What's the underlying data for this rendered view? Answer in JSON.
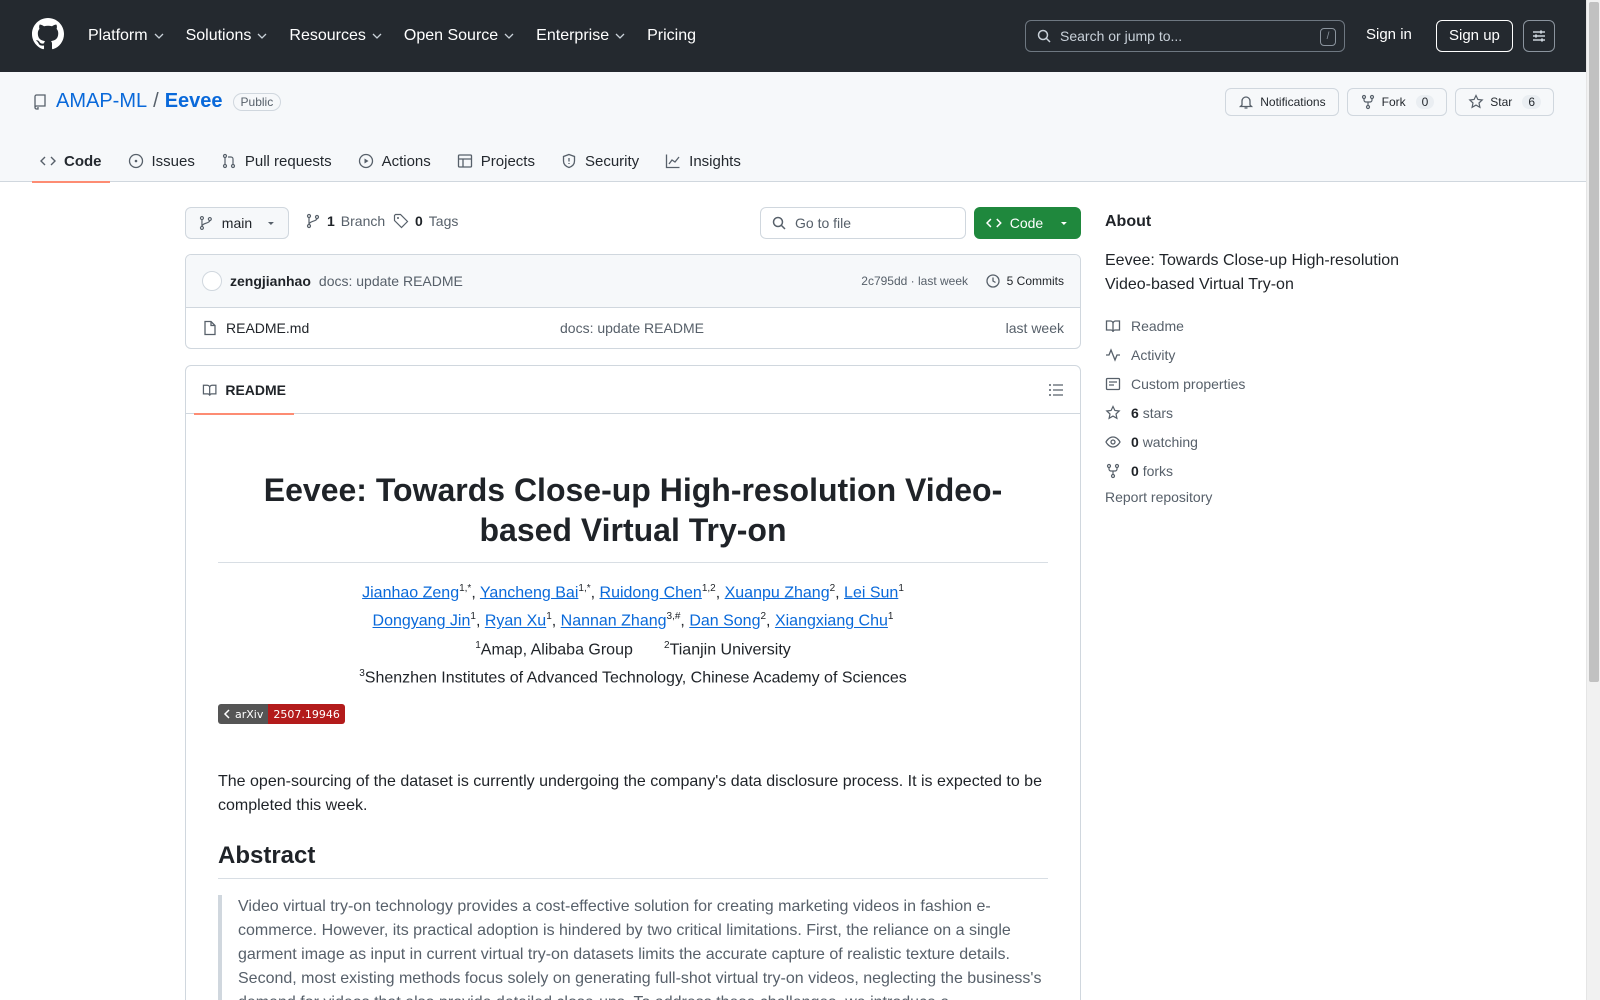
{
  "topnav": {
    "items": [
      {
        "label": "Platform",
        "dropdown": true
      },
      {
        "label": "Solutions",
        "dropdown": true
      },
      {
        "label": "Resources",
        "dropdown": true
      },
      {
        "label": "Open Source",
        "dropdown": true
      },
      {
        "label": "Enterprise",
        "dropdown": true
      },
      {
        "label": "Pricing",
        "dropdown": false
      }
    ],
    "search_placeholder": "Search or jump to...",
    "search_shortcut": "/",
    "signin": "Sign in",
    "signup": "Sign up"
  },
  "repo": {
    "owner": "AMAP-ML",
    "separator": "/",
    "name": "Eevee",
    "visibility": "Public",
    "notifications_label": "Notifications",
    "fork_label": "Fork",
    "fork_count": "0",
    "star_label": "Star",
    "star_count": "6"
  },
  "tabs": [
    {
      "label": "Code",
      "icon": "code-icon"
    },
    {
      "label": "Issues",
      "icon": "issue-icon"
    },
    {
      "label": "Pull requests",
      "icon": "pull-request-icon"
    },
    {
      "label": "Actions",
      "icon": "play-icon"
    },
    {
      "label": "Projects",
      "icon": "table-icon"
    },
    {
      "label": "Security",
      "icon": "shield-icon"
    },
    {
      "label": "Insights",
      "icon": "graph-icon"
    }
  ],
  "toolbar": {
    "branch": "main",
    "branch_count": "1",
    "branch_label": "Branch",
    "tag_count": "0",
    "tag_label": "Tags",
    "goto_placeholder": "Go to file",
    "code_label": "Code"
  },
  "commit": {
    "author": "zengjianhao",
    "message": "docs: update README",
    "meta": "2c795dd · last week",
    "commits": "5 Commits"
  },
  "files": [
    {
      "name": "README.md",
      "message": "docs: update README",
      "time": "last week"
    }
  ],
  "readme": {
    "tab_label": "README",
    "title": "Eevee: Towards Close-up High-resolution Video-based Virtual Try-on",
    "authors_line1": [
      {
        "name": "Jianhao Zeng",
        "sup": "1,*"
      },
      {
        "name": "Yancheng Bai",
        "sup": "1,*"
      },
      {
        "name": "Ruidong Chen",
        "sup": "1,2"
      },
      {
        "name": "Xuanpu Zhang",
        "sup": "2"
      },
      {
        "name": "Lei Sun",
        "sup": "1"
      }
    ],
    "authors_line2": [
      {
        "name": "Dongyang Jin",
        "sup": "1"
      },
      {
        "name": "Ryan Xu",
        "sup": "1"
      },
      {
        "name": "Nannan Zhang",
        "sup": "3,#"
      },
      {
        "name": "Dan Song",
        "sup": "2"
      },
      {
        "name": "Xiangxiang Chu",
        "sup": "1"
      }
    ],
    "affil1_sup": "1",
    "affil1": "Amap, Alibaba Group",
    "affil2_sup": "2",
    "affil2": "Tianjin University",
    "affil3_sup": "3",
    "affil3": "Shenzhen Institutes of Advanced Technology, Chinese Academy of Sciences",
    "badge_left": "arXiv",
    "badge_right": "2507.19946",
    "notice": "The open-sourcing of the dataset is currently undergoing the company's data disclosure process. It is expected to be completed this week.",
    "abstract_heading": "Abstract",
    "abstract": "Video virtual try-on technology provides a cost-effective solution for creating marketing videos in fashion e-commerce. However, its practical adoption is hindered by two critical limitations. First, the reliance on a single garment image as input in current virtual try-on datasets limits the accurate capture of realistic texture details. Second, most existing methods focus solely on generating full-shot virtual try-on videos, neglecting the business's demand for videos that also provide detailed close-ups. To address these challenges, we introduce a"
  },
  "about": {
    "heading": "About",
    "description": "Eevee: Towards Close-up High-resolution Video-based Virtual Try-on",
    "readme": "Readme",
    "activity": "Activity",
    "custom_properties": "Custom properties",
    "stars_count": "6",
    "stars_label": "stars",
    "watching_count": "0",
    "watching_label": "watching",
    "forks_count": "0",
    "forks_label": "forks",
    "report": "Report repository"
  },
  "colors": {
    "header_bg": "#24292f",
    "link": "#0969da",
    "code_button": "#1f883d",
    "tab_underline": "#fd8c73",
    "badge_red": "#b31b1b"
  }
}
